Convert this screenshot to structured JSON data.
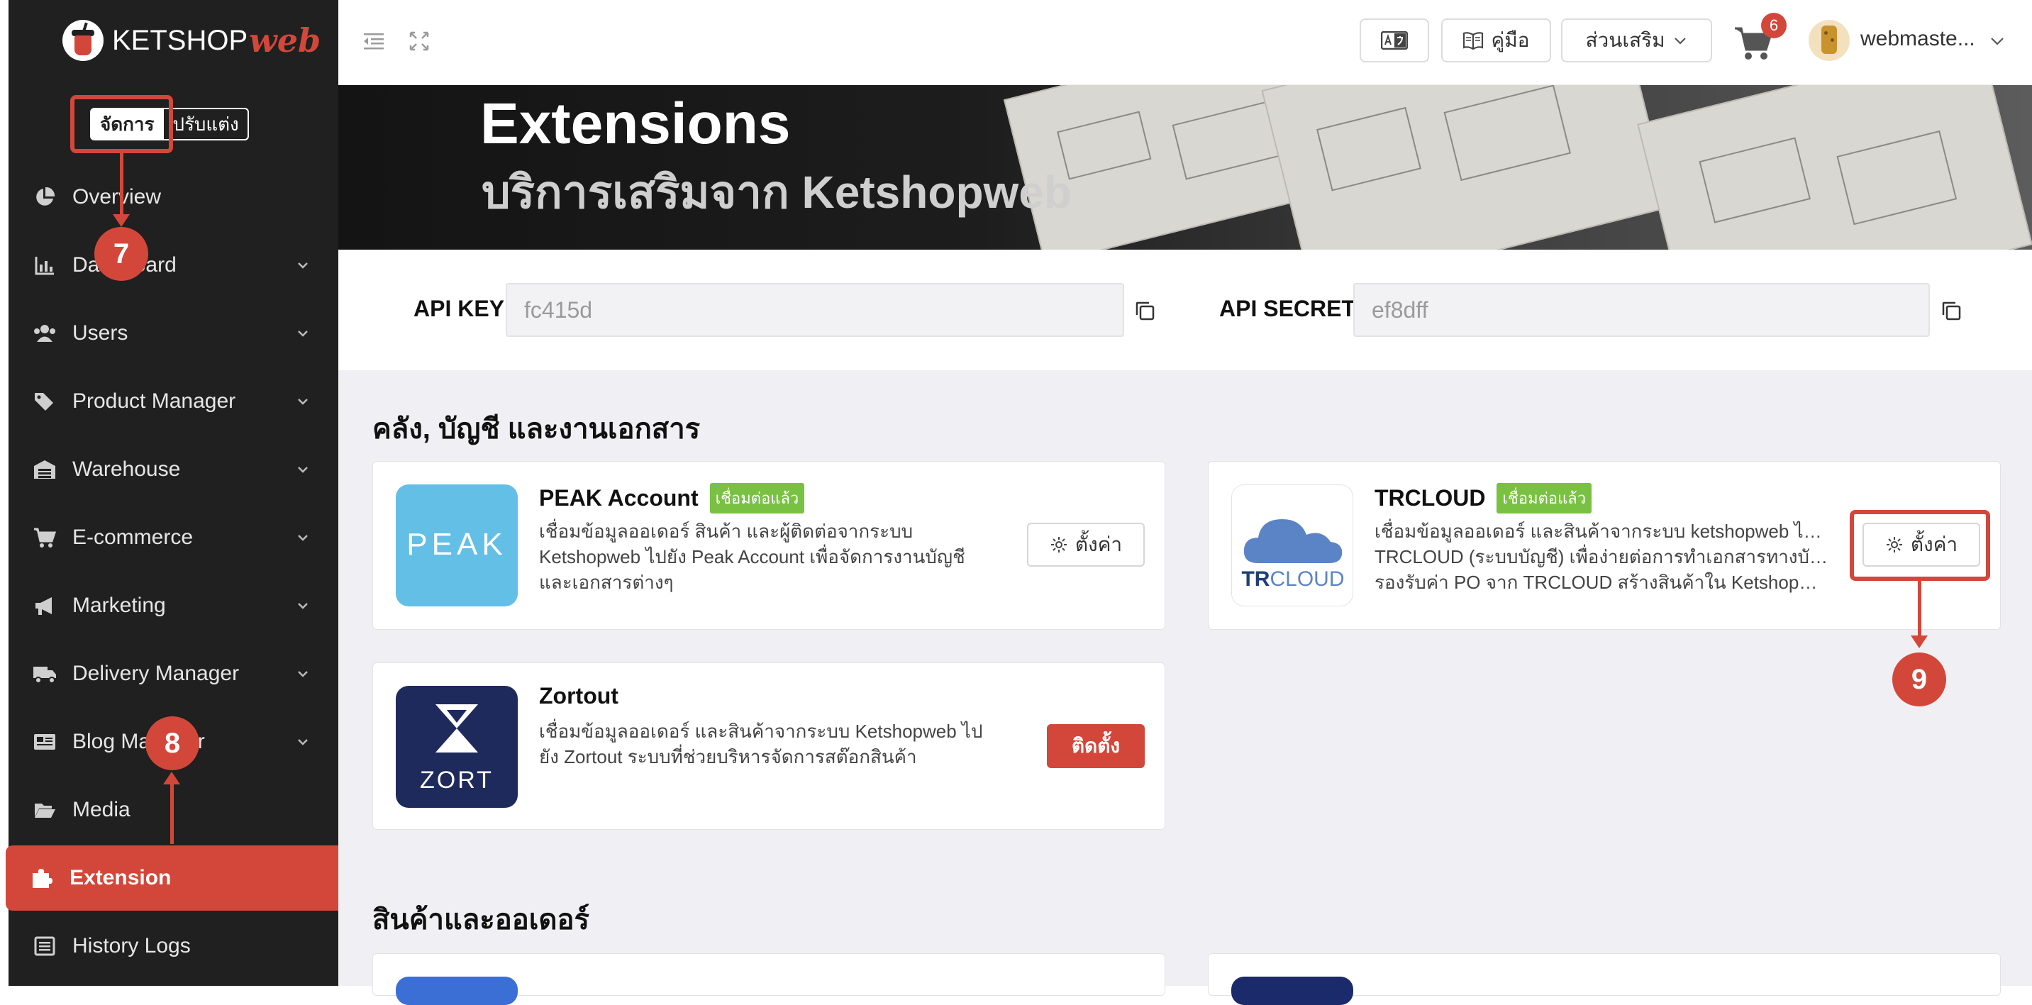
{
  "brand": {
    "name": "KETSHOP",
    "accent": "web"
  },
  "mode": {
    "manage": "จัดการ",
    "customize": "ปรับแต่ง"
  },
  "sidebar": {
    "items": [
      {
        "label": "Overview"
      },
      {
        "label": "Dashboard"
      },
      {
        "label": "Users"
      },
      {
        "label": "Product Manager"
      },
      {
        "label": "Warehouse"
      },
      {
        "label": "E-commerce"
      },
      {
        "label": "Marketing"
      },
      {
        "label": "Delivery Manager"
      },
      {
        "label": "Blog Manager"
      },
      {
        "label": "Media"
      },
      {
        "label": "Extension"
      },
      {
        "label": "History Logs"
      }
    ]
  },
  "topbar": {
    "manual_label": "คู่มือ",
    "addons_label": "ส่วนเสริม",
    "cart_count": "6",
    "username": "webmaste..."
  },
  "hero": {
    "title": "Extensions",
    "subtitle": "บริการเสริมจาก Ketshopweb"
  },
  "api": {
    "key_label": "API KEY",
    "key_value": "fc415d",
    "secret_label": "API SECRET",
    "secret_value": "ef8dff"
  },
  "sections": [
    {
      "title": "คลัง, บัญชี และงานเอกสาร"
    },
    {
      "title": "สินค้าและออเดอร์"
    }
  ],
  "cards": {
    "peak": {
      "logo_text": "PEAK",
      "title": "PEAK Account",
      "badge": "เชื่อมต่อแล้ว",
      "desc": "เชื่อมข้อมูลออเดอร์ สินค้า และผู้ติดต่อจากระบบ Ketshopweb ไปยัง Peak Account เพื่อจัดการงานบัญชีและเอกสารต่างๆ",
      "button": "ตั้งค่า"
    },
    "trcloud": {
      "logo_tr": "TR",
      "logo_cloud": "CLOUD",
      "title": "TRCLOUD",
      "badge": "เชื่อมต่อแล้ว",
      "desc1": "เชื่อมข้อมูลออเดอร์ และสินค้าจากระบบ ketshopweb ไปยัง",
      "desc2": "TRCLOUD (ระบบบัญชี) เพื่อง่ายต่อการทำเอกสารทางบัญชี",
      "desc3": "รองรับค่า PO จาก TRCLOUD สร้างสินค้าใน Ketshopweb...",
      "button": "ตั้งค่า"
    },
    "zortout": {
      "logo_text": "ZORT",
      "title": "Zortout",
      "desc": "เชื่อมข้อมูลออเดอร์ และสินค้าจากระบบ Ketshopweb ไปยัง Zortout ระบบที่ช่วยบริหารจัดการสต๊อกสินค้า",
      "button": "ติดตั้ง"
    }
  },
  "annotations": {
    "n7": "7",
    "n8": "8",
    "n9": "9"
  },
  "colors": {
    "accent": "#d3473a",
    "sidebar_bg": "#202020",
    "badge_green": "#79c142",
    "content_bg": "#f0f0f4",
    "peak_blue": "#63bfe6",
    "zort_navy": "#1f2a5c",
    "trcloud_blue": "#5b84c6"
  }
}
